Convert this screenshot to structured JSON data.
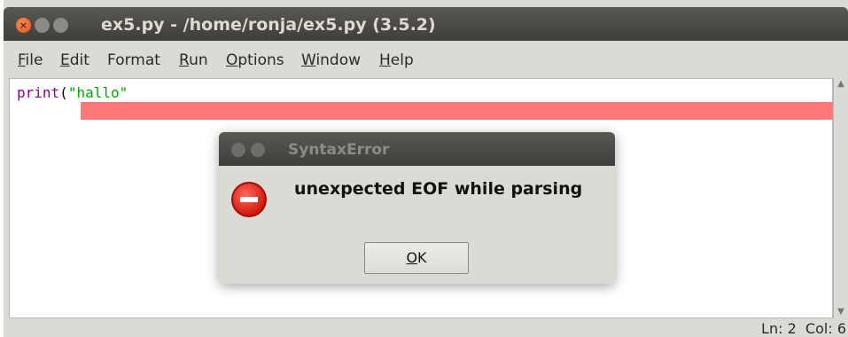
{
  "window": {
    "title": "ex5.py - /home/ronja/ex5.py (3.5.2)",
    "close_glyph": "×"
  },
  "menu": {
    "items": [
      {
        "first": "F",
        "rest": "ile"
      },
      {
        "first": "E",
        "rest": "dit"
      },
      {
        "first": "F",
        "rest": "ormat",
        "prefix": ""
      },
      {
        "first": "R",
        "rest": "un"
      },
      {
        "first": "O",
        "rest": "ptions"
      },
      {
        "first": "W",
        "rest": "indow"
      },
      {
        "first": "H",
        "rest": "elp"
      }
    ]
  },
  "editor": {
    "keyword": "print",
    "open_paren": "(",
    "string": "\"hallo\"",
    "highlight_color": "#ff7777"
  },
  "status": {
    "text": "Ln: 2  Col: 6"
  },
  "dialog": {
    "title": "SyntaxError",
    "message": "unexpected EOF while parsing",
    "ok_first": "O",
    "ok_rest": "K",
    "icon": "error-stop-icon"
  }
}
